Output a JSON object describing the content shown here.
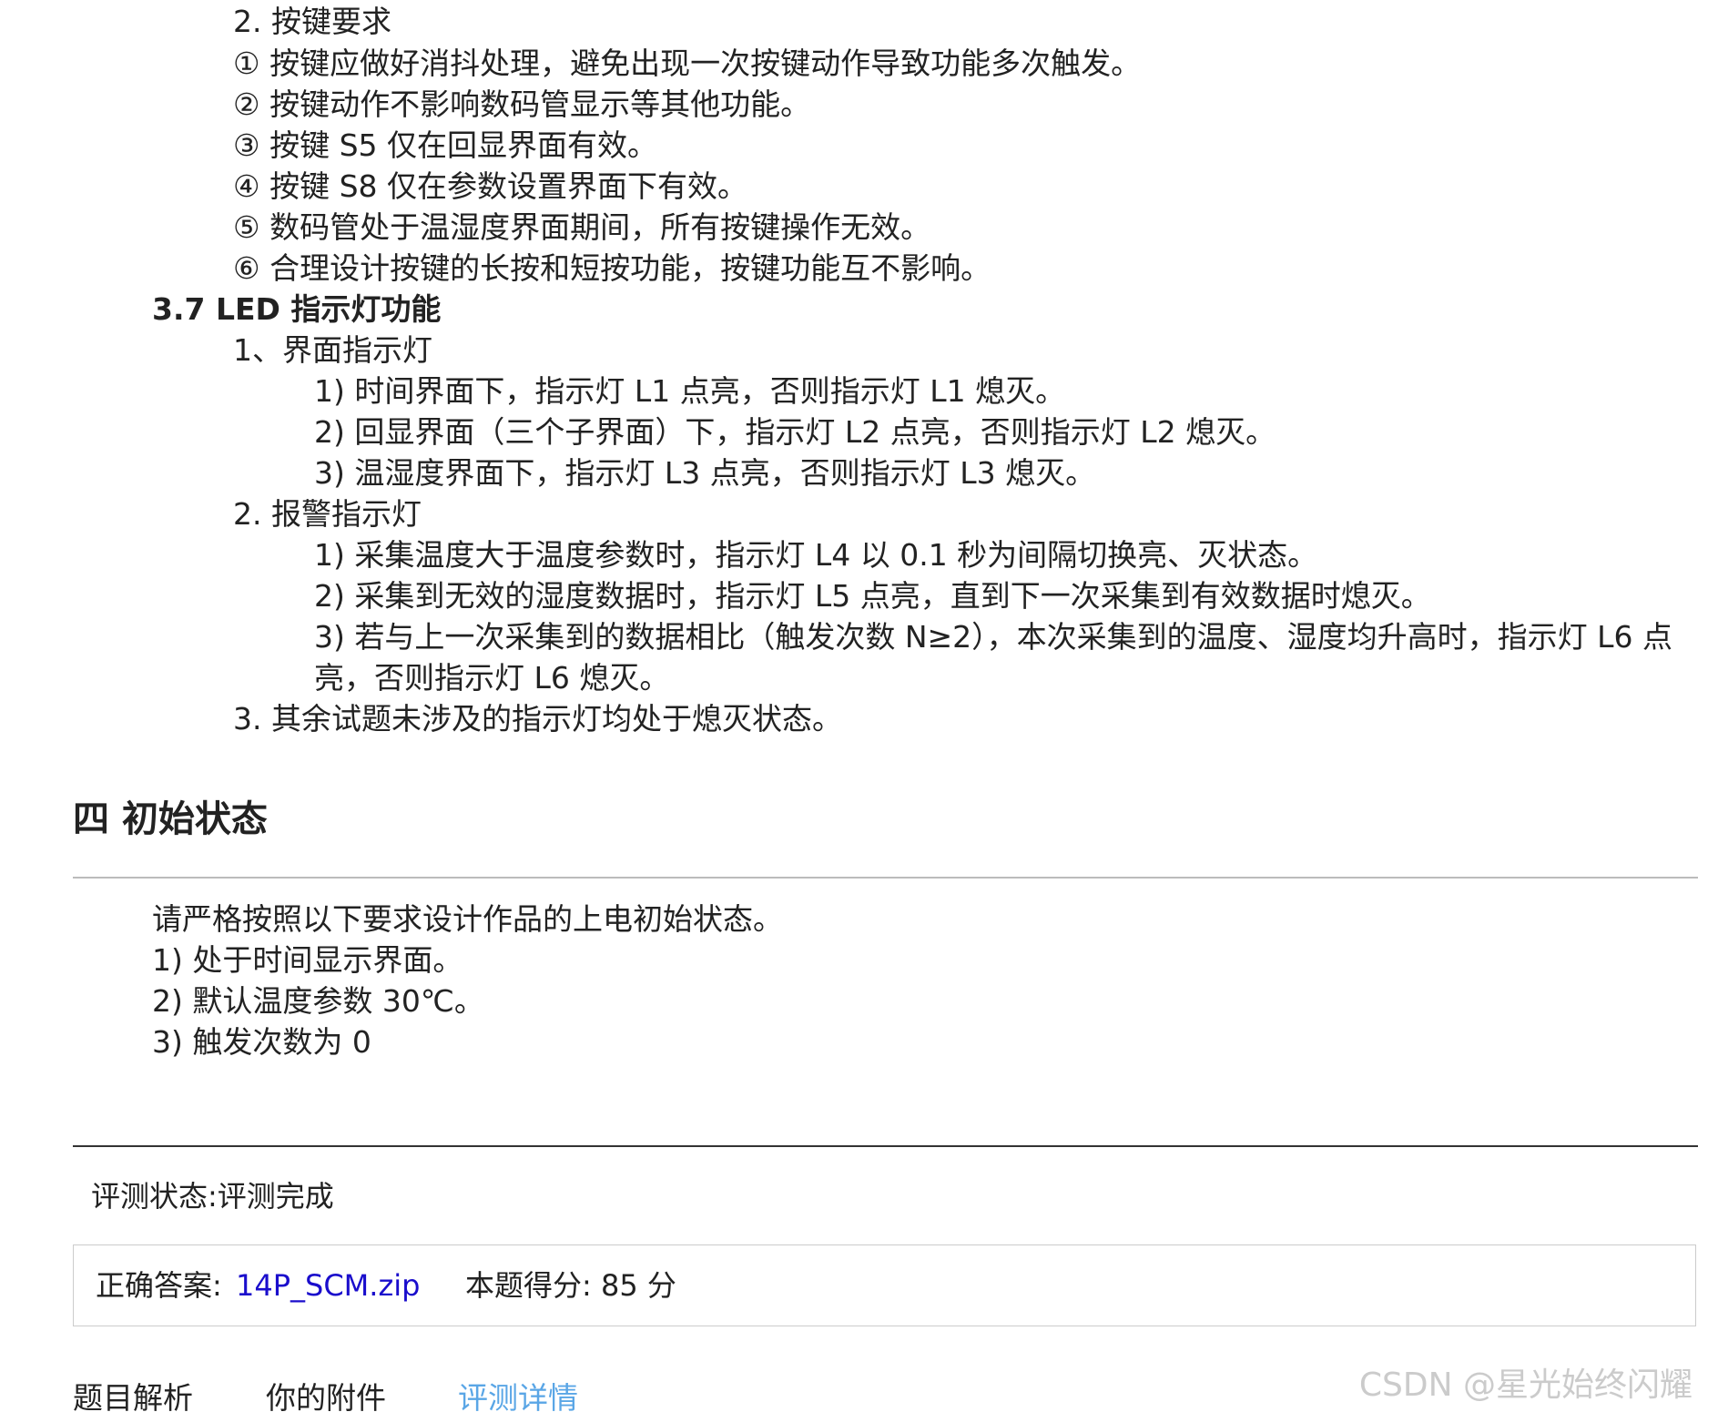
{
  "key_requirements": {
    "heading": "2. 按键要求",
    "items": [
      "① 按键应做好消抖处理，避免出现一次按键动作导致功能多次触发。",
      "② 按键动作不影响数码管显示等其他功能。",
      "③ 按键 S5 仅在回显界面有效。",
      "④ 按键 S8 仅在参数设置界面下有效。",
      "⑤ 数码管处于温湿度界面期间，所有按键操作无效。",
      "⑥ 合理设计按键的长按和短按功能，按键功能互不影响。"
    ]
  },
  "led_section": {
    "heading": "3.7 LED 指示灯功能",
    "interface": {
      "heading": "1、界面指示灯",
      "items": [
        "1) 时间界面下，指示灯 L1 点亮，否则指示灯 L1 熄灭。",
        "2) 回显界面（三个子界面）下，指示灯 L2 点亮，否则指示灯 L2 熄灭。",
        "3) 温湿度界面下，指示灯 L3 点亮，否则指示灯 L3 熄灭。"
      ]
    },
    "alarm": {
      "heading": "2. 报警指示灯",
      "items": [
        "1) 采集温度大于温度参数时，指示灯 L4 以 0.1 秒为间隔切换亮、灭状态。",
        "2) 采集到无效的湿度数据时，指示灯 L5 点亮，直到下一次采集到有效数据时熄灭。",
        "3) 若与上一次采集到的数据相比（触发次数 N≥2），本次采集到的温度、湿度均升高时，指示灯 L6 点",
        "亮，否则指示灯 L6 熄灭。"
      ]
    },
    "other": "3. 其余试题未涉及的指示灯均处于熄灭状态。"
  },
  "initial_state": {
    "title": "四 初始状态",
    "intro": "请严格按照以下要求设计作品的上电初始状态。",
    "items": [
      "1) 处于时间显示界面。",
      "2) 默认温度参数 30℃。",
      "3) 触发次数为 0"
    ]
  },
  "evaluation": {
    "status_label": "评测状态:",
    "status_value": "评测完成",
    "answer_label": "正确答案:",
    "answer_file": "14P_SCM.zip",
    "score_text": "本题得分: 85 分"
  },
  "tabs": [
    {
      "label": "题目解析",
      "active": false
    },
    {
      "label": "你的附件",
      "active": false
    },
    {
      "label": "评测详情",
      "active": true
    }
  ],
  "colors": {
    "link": "#1a0dcc",
    "active_tab": "#5aa6e6"
  },
  "watermark": "CSDN @星光始终闪耀"
}
